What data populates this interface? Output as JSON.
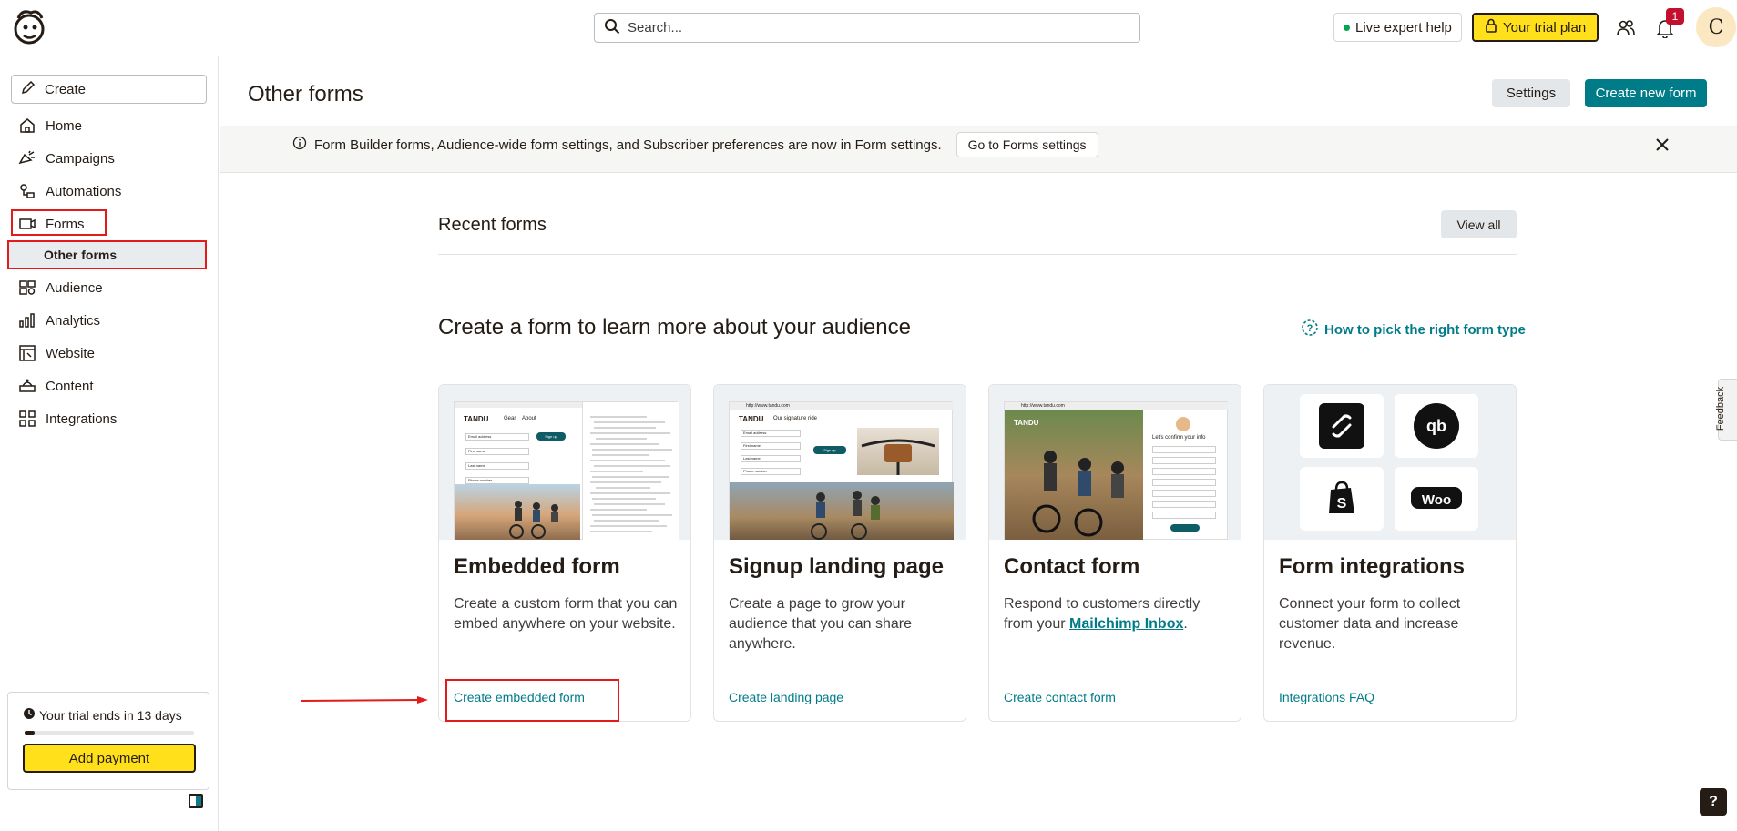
{
  "header": {
    "search_placeholder": "Search...",
    "live_help": "Live expert help",
    "trial_plan": "Your trial plan",
    "notification_count": "1",
    "avatar_initial": "C"
  },
  "sidebar": {
    "create_label": "Create",
    "items": [
      {
        "label": "Home",
        "icon": "home-icon"
      },
      {
        "label": "Campaigns",
        "icon": "megaphone-icon"
      },
      {
        "label": "Automations",
        "icon": "automation-icon"
      },
      {
        "label": "Forms",
        "icon": "forms-icon"
      },
      {
        "label": "Audience",
        "icon": "audience-icon"
      },
      {
        "label": "Analytics",
        "icon": "analytics-icon"
      },
      {
        "label": "Website",
        "icon": "website-icon"
      },
      {
        "label": "Content",
        "icon": "content-icon"
      },
      {
        "label": "Integrations",
        "icon": "integrations-icon"
      }
    ],
    "sub_item": "Other forms",
    "trial_text": "Your trial ends in 13 days",
    "trial_progress": 0.06,
    "add_payment": "Add payment"
  },
  "page": {
    "title": "Other forms",
    "settings": "Settings",
    "create_new_form": "Create new form"
  },
  "banner": {
    "text": "Form Builder forms, Audience-wide form settings, and Subscriber preferences are now in Form settings.",
    "button": "Go to Forms settings"
  },
  "recent": {
    "title": "Recent forms",
    "view_all": "View all"
  },
  "create_section": {
    "heading": "Create a form to learn more about your audience",
    "help_link": "How to pick the right form type"
  },
  "cards": [
    {
      "title": "Embedded form",
      "desc": "Create a custom form that you can embed anywhere on your website.",
      "link": "Create embedded form"
    },
    {
      "title": "Signup landing page",
      "desc": "Create a page to grow your audience that you can share anywhere.",
      "link": "Create landing page"
    },
    {
      "title": "Contact form",
      "desc_before": "Respond to customers directly from your ",
      "desc_link": "Mailchimp Inbox",
      "desc_after": ".",
      "link": "Create contact form"
    },
    {
      "title": "Form integrations",
      "desc": "Connect your form to collect customer data and increase revenue.",
      "link": "Integrations FAQ"
    }
  ],
  "mock_text": {
    "brand": "TANDU",
    "nav_gear": "Gear",
    "nav_about": "About",
    "sign_up": "Sign up",
    "url": "http://www.tandu.com",
    "tagline": "Our signature ride",
    "confirm": "Let's confirm your info",
    "fields": [
      "Email address",
      "First name",
      "Last name",
      "Phone number"
    ]
  },
  "integrations": [
    "squarespace-logo",
    "quickbooks-logo",
    "shopify-logo",
    "woo-logo"
  ],
  "feedback": "Feedback",
  "help": "?",
  "colors": {
    "accent": "#007c89",
    "brand_yellow": "#ffe01b",
    "highlight": "#e41b1b"
  }
}
